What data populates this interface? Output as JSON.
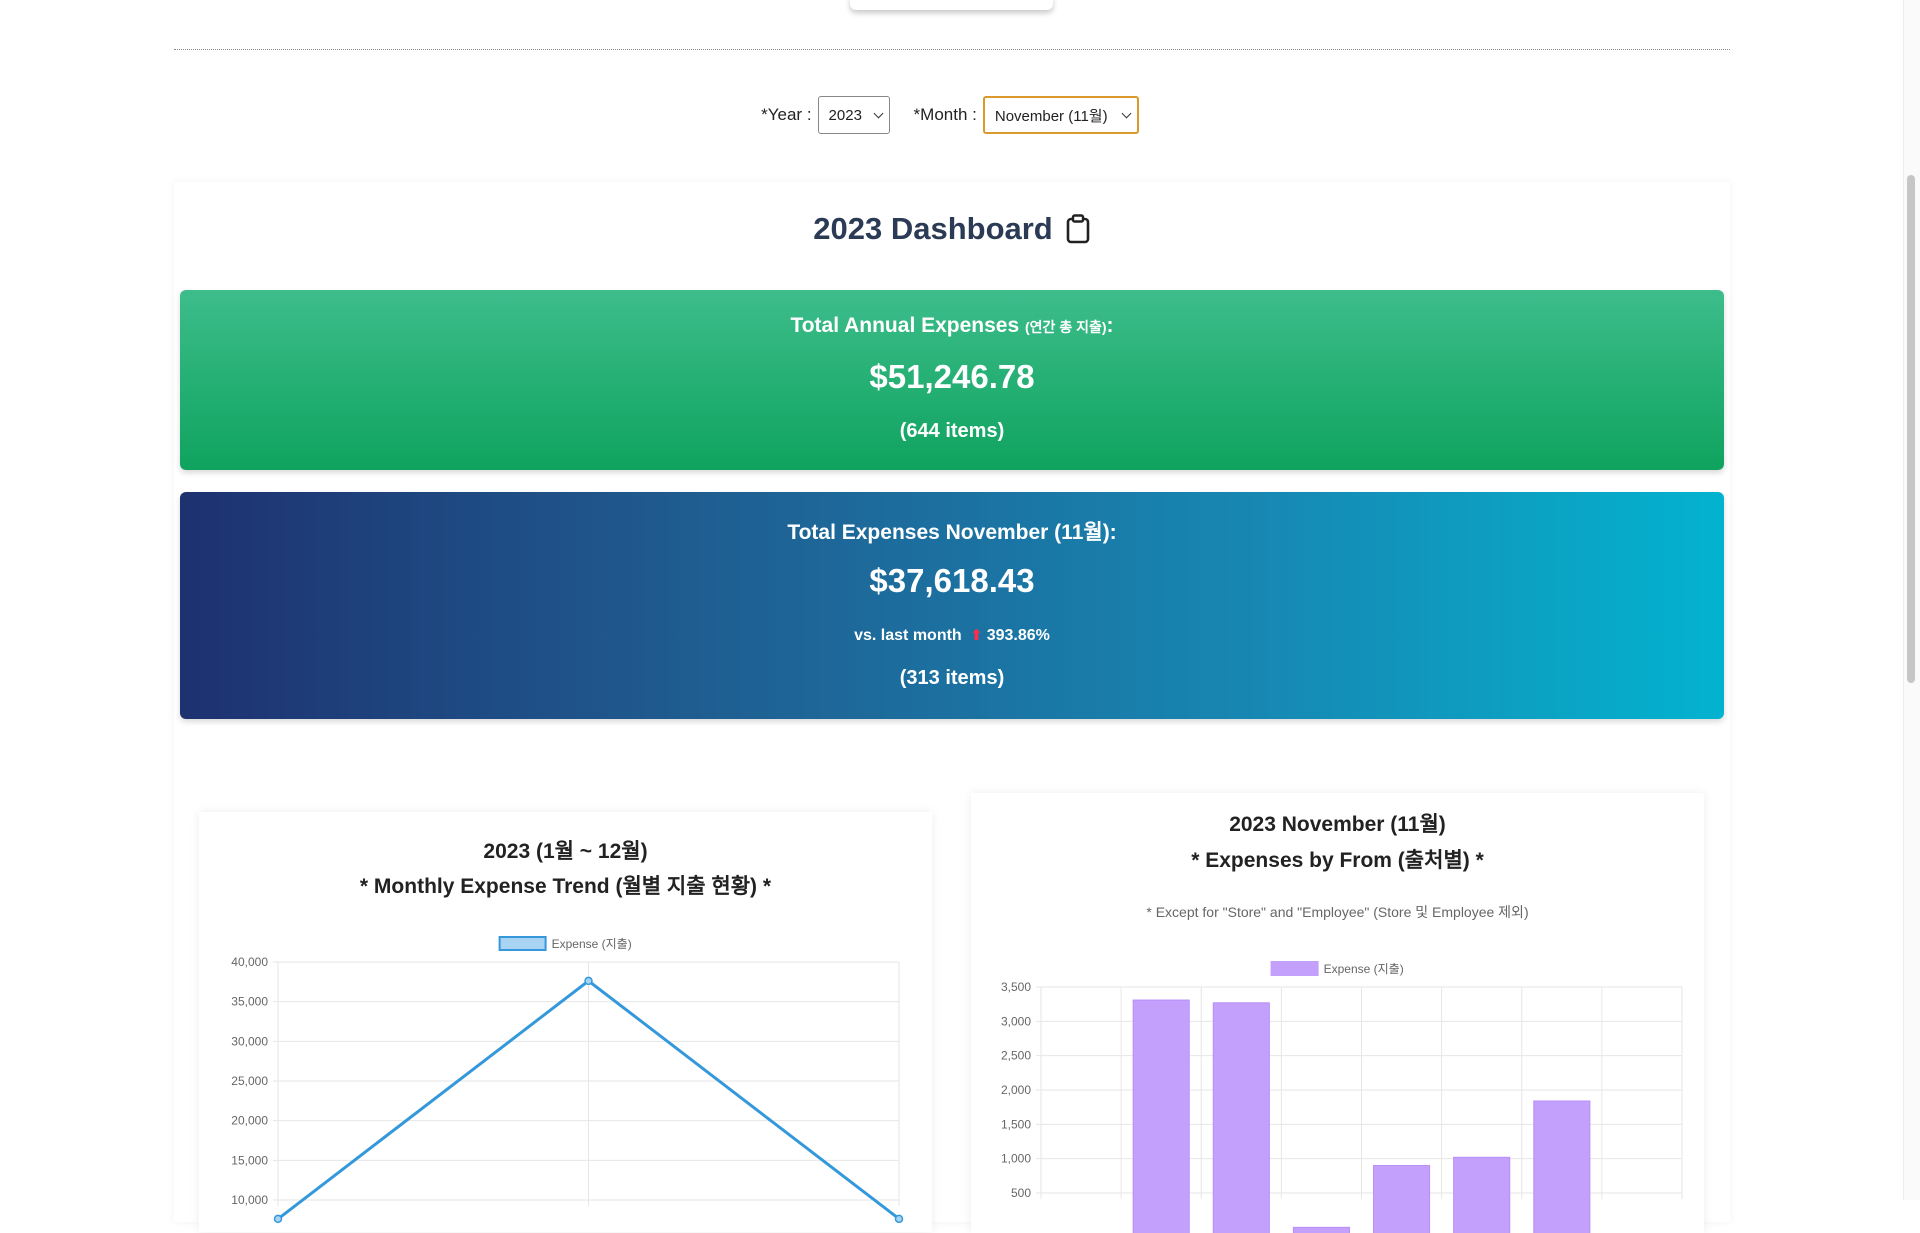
{
  "selectors": {
    "year_label": "*Year :",
    "year_value": "2023",
    "month_label": "*Month :",
    "month_value": "November (11월)"
  },
  "dashboard": {
    "title": "2023 Dashboard"
  },
  "annual": {
    "label": "Total Annual Expenses",
    "label_small": "(연간 총 지출)",
    "label_suffix": ":",
    "amount": "$51,246.78",
    "count": "(644 items)"
  },
  "monthly": {
    "label": "Total Expenses November (11월):",
    "amount": "$37,618.43",
    "compare_label": "vs. last month",
    "compare_value": "393.86%",
    "count": "(313 items)"
  },
  "colors": {
    "line_series": "#3498db",
    "bar_series": "#c3a0fb",
    "bar_border": "#b98ff8",
    "up_arrow": "#ff2d4a"
  },
  "chart_data": [
    {
      "type": "line",
      "title": "2023 (1월 ~ 12월)",
      "subtitle": "* Monthly Expense Trend (월별 지출 현황) *",
      "series": [
        {
          "name": "Expense (지출)",
          "values": [
            7618,
            37618,
            7628
          ]
        }
      ],
      "ytick_labels": [
        "40,000",
        "35,000",
        "30,000",
        "25,000",
        "20,000",
        "15,000",
        "10,000"
      ],
      "ylim": [
        10000,
        40000
      ],
      "grid": true,
      "legend": "top"
    },
    {
      "type": "bar",
      "title": "2023 November (11월)",
      "subtitle": "* Expenses by From (출처별) *",
      "note": "* Except for \"Store\" and \"Employee\" (Store 및 Employee 제외)",
      "series": [
        {
          "name": "Expense (지출)",
          "values": [
            3310,
            3270,
            0,
            900,
            1020,
            1840
          ]
        }
      ],
      "ytick_labels": [
        "3,500",
        "3,000",
        "2,500",
        "2,000",
        "1,500",
        "1,000",
        "500"
      ],
      "ylim": [
        500,
        3500
      ],
      "grid": true,
      "legend": "top"
    }
  ]
}
